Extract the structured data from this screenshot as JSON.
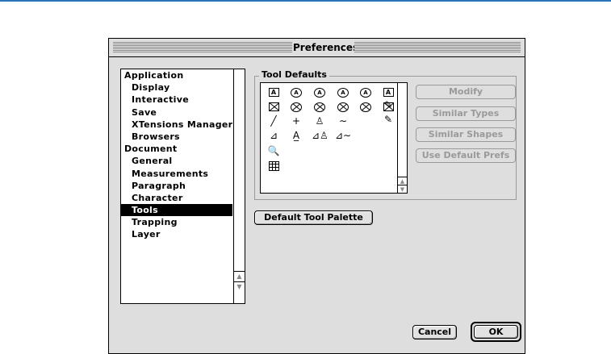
{
  "window": {
    "title": "Preferences"
  },
  "categories": [
    {
      "label": "Application",
      "level": "top",
      "selected": false
    },
    {
      "label": "Display",
      "level": "sub",
      "selected": false
    },
    {
      "label": "Interactive",
      "level": "sub",
      "selected": false
    },
    {
      "label": "Save",
      "level": "sub",
      "selected": false
    },
    {
      "label": "XTensions Manager",
      "level": "sub",
      "selected": false
    },
    {
      "label": "Browsers",
      "level": "sub",
      "selected": false
    },
    {
      "label": "Document",
      "level": "top",
      "selected": false
    },
    {
      "label": "General",
      "level": "sub",
      "selected": false
    },
    {
      "label": "Measurements",
      "level": "sub",
      "selected": false
    },
    {
      "label": "Paragraph",
      "level": "sub",
      "selected": false
    },
    {
      "label": "Character",
      "level": "sub",
      "selected": false
    },
    {
      "label": "Tools",
      "level": "sub",
      "selected": true
    },
    {
      "label": "Trapping",
      "level": "sub",
      "selected": false
    },
    {
      "label": "Layer",
      "level": "sub",
      "selected": false
    }
  ],
  "tool_defaults": {
    "label": "Tool Defaults",
    "tools": [
      {
        "icon": "text-box-rect-icon"
      },
      {
        "icon": "text-box-rounded-icon"
      },
      {
        "icon": "text-box-concave-icon"
      },
      {
        "icon": "text-box-beveled-icon"
      },
      {
        "icon": "text-box-oval-icon"
      },
      {
        "icon": "text-box-bezier-icon"
      },
      {
        "icon": "picture-box-rect-icon"
      },
      {
        "icon": "picture-box-rounded-icon"
      },
      {
        "icon": "picture-box-concave-icon"
      },
      {
        "icon": "picture-box-beveled-icon"
      },
      {
        "icon": "picture-box-oval-icon"
      },
      {
        "icon": "picture-box-bezier-icon"
      },
      {
        "icon": "line-tool-icon"
      },
      {
        "icon": "orthogonal-line-icon"
      },
      {
        "icon": "bezier-pen-icon"
      },
      {
        "icon": "freehand-line-icon"
      },
      {
        "icon": "text-path-icon"
      },
      {
        "icon": "orthogonal-text-path-icon"
      },
      {
        "icon": "bezier-text-path-icon"
      },
      {
        "icon": "freehand-text-path-icon"
      },
      {
        "icon": "zoom-icon"
      },
      {
        "icon": "table-icon"
      }
    ],
    "buttons": {
      "modify": "Modify",
      "similar_types": "Similar Types",
      "similar_shapes": "Similar Shapes",
      "use_default_prefs": "Use Default Prefs"
    }
  },
  "default_tool_palette": "Default Tool Palette",
  "footer": {
    "cancel": "Cancel",
    "ok": "OK"
  }
}
